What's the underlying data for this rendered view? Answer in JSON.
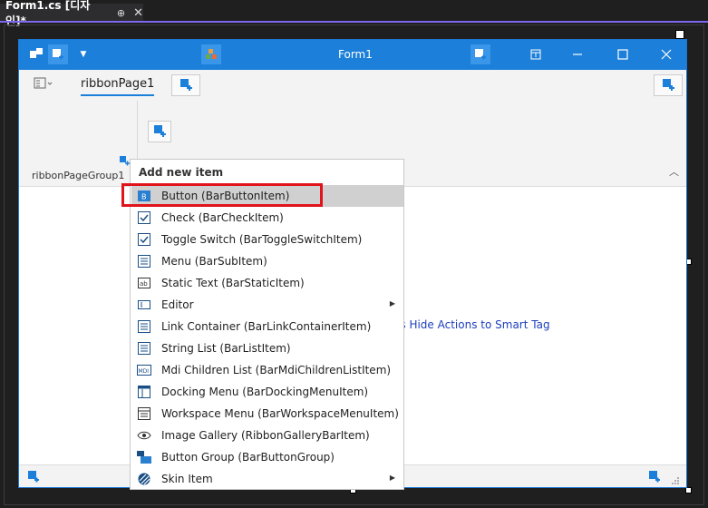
{
  "doc_tab": {
    "title": "Form1.cs [디자인]*",
    "pin": "⊕",
    "close": "✕"
  },
  "form": {
    "title": "Form1",
    "ribbon_page": "ribbonPage1",
    "ribbon_group": "ribbonPageGroup1",
    "smart_tag_hint": "es  Hide Actions to Smart Tag"
  },
  "menu": {
    "header": "Add new item",
    "items": [
      {
        "label": "Button (BarButtonItem)",
        "icon": "button-icon",
        "has_submenu": false,
        "selected": true
      },
      {
        "label": "Check (BarCheckItem)",
        "icon": "check-icon",
        "has_submenu": false
      },
      {
        "label": "Toggle Switch (BarToggleSwitchItem)",
        "icon": "toggle-icon",
        "has_submenu": false
      },
      {
        "label": "Menu (BarSubItem)",
        "icon": "menu-icon",
        "has_submenu": false
      },
      {
        "label": "Static Text (BarStaticItem)",
        "icon": "static-text-icon",
        "has_submenu": false
      },
      {
        "label": "Editor",
        "icon": "editor-icon",
        "has_submenu": true
      },
      {
        "label": "Link Container (BarLinkContainerItem)",
        "icon": "link-container-icon",
        "has_submenu": false
      },
      {
        "label": "String List (BarListItem)",
        "icon": "string-list-icon",
        "has_submenu": false
      },
      {
        "label": "Mdi Children List (BarMdiChildrenListItem)",
        "icon": "mdi-icon",
        "has_submenu": false
      },
      {
        "label": "Docking Menu (BarDockingMenuItem)",
        "icon": "docking-menu-icon",
        "has_submenu": false
      },
      {
        "label": "Workspace Menu (BarWorkspaceMenuItem)",
        "icon": "workspace-menu-icon",
        "has_submenu": false
      },
      {
        "label": "Image Gallery (RibbonGalleryBarItem)",
        "icon": "eye-icon",
        "has_submenu": false
      },
      {
        "label": "Button Group (BarButtonGroup)",
        "icon": "button-group-icon",
        "has_submenu": false
      },
      {
        "label": "Skin Item",
        "icon": "skin-icon",
        "has_submenu": true
      }
    ]
  },
  "colors": {
    "accent": "#1c7fd9",
    "highlight": "#e0141b"
  }
}
